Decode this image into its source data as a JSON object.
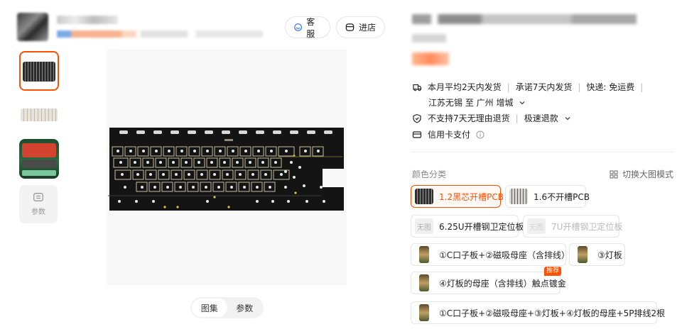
{
  "header": {
    "service_label": "客服",
    "store_label": "进店"
  },
  "gallery": {
    "params_label": "参数",
    "tabs": [
      "图集",
      "参数"
    ],
    "active_tab": 0
  },
  "product": {
    "shipping_info": "本月平均2天内发货",
    "shipping_promise": "承诺7天内发货",
    "shipping_fee": "快递: 免运费",
    "route": "江苏无锡 至 广州 增城",
    "return_policy": "不支持7天无理由退货",
    "refund": "极速退款",
    "payment": "信用卡支付"
  },
  "sku": {
    "label": "颜色分类",
    "switch_view_label": "切换大图模式",
    "options": [
      {
        "label": "1.2黑芯开槽PCB",
        "state": "selected"
      },
      {
        "label": "1.6不开槽PCB",
        "state": "normal"
      },
      {
        "label": "6.25U开槽钢卫定位板",
        "state": "normal",
        "no_image": "无图"
      },
      {
        "label": "7U开槽钢卫定位板",
        "state": "disabled",
        "no_image": "无图"
      },
      {
        "label": "①C口子板+②磁吸母座（含排线）",
        "state": "normal"
      },
      {
        "label": "③灯板",
        "state": "normal"
      },
      {
        "label": "④灯板的母座（含排线）触点镀金",
        "state": "normal",
        "badge": "推荐"
      },
      {
        "label": "①C口子板+②磁吸母座+③灯板+④灯板的母座+5P排线2根",
        "state": "normal"
      }
    ]
  },
  "colors": {
    "accent": "#ff5000",
    "border": "#e6e6e6",
    "muted": "#888888"
  }
}
